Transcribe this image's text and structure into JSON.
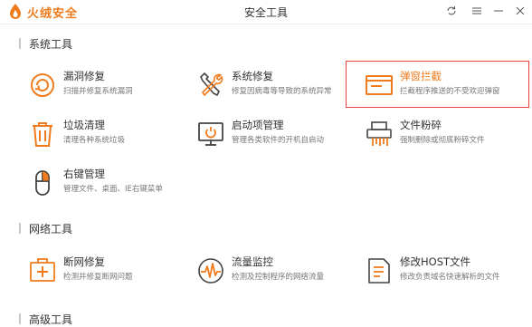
{
  "app": {
    "brand": "火绒安全",
    "window_title": "安全工具"
  },
  "sections": {
    "system": {
      "title": "系统工具",
      "tools": {
        "vuln_repair": {
          "name": "漏洞修复",
          "desc": "扫描并修复系统漏洞"
        },
        "sys_repair": {
          "name": "系统修复",
          "desc": "修复因病毒等导致的系统异常"
        },
        "popup_block": {
          "name": "弹窗拦截",
          "desc": "拦截程序推送的不受欢迎弹窗"
        },
        "junk_clean": {
          "name": "垃圾清理",
          "desc": "清理各种系统垃圾"
        },
        "startup_mgr": {
          "name": "启动项管理",
          "desc": "管理各类软件的开机自启动"
        },
        "file_shred": {
          "name": "文件粉碎",
          "desc": "强制删除或彻底粉碎文件"
        },
        "context_menu": {
          "name": "右键管理",
          "desc": "管理文件、桌面、IE右键菜单"
        }
      }
    },
    "network": {
      "title": "网络工具",
      "tools": {
        "net_repair": {
          "name": "断网修复",
          "desc": "检测并修复断网问题"
        },
        "traffic_monitor": {
          "name": "流量监控",
          "desc": "检测及控制程序的网络流量"
        },
        "host_edit": {
          "name": "修改HOST文件",
          "desc": "修改负责域名快速解析的文件"
        }
      }
    },
    "advanced": {
      "title": "高级工具"
    }
  },
  "colors": {
    "accent": "#f07b1c",
    "highlight_border": "#e8403b"
  },
  "icons": [
    "shield-refresh-icon",
    "wrench-screwdriver-icon",
    "popup-window-icon",
    "trash-bin-icon",
    "monitor-startup-icon",
    "shredder-icon",
    "mouse-icon",
    "network-repair-icon",
    "traffic-wave-icon",
    "host-document-icon"
  ]
}
